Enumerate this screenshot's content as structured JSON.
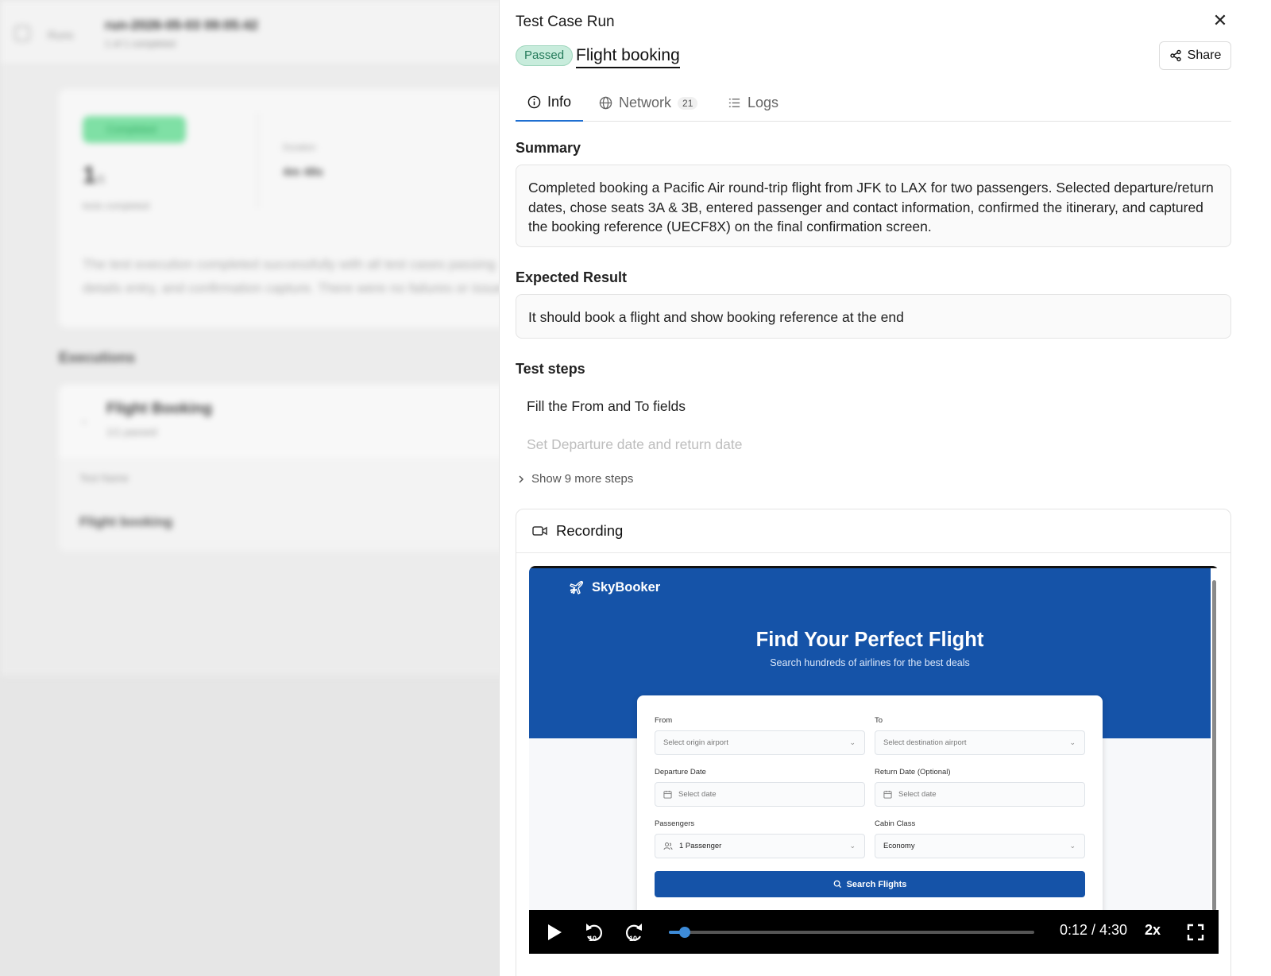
{
  "background": {
    "breadcrumb": "Runs",
    "run_title": "run-2026-05-03 09:05:42",
    "run_subtitle": "1 of 1 completed",
    "status": "Completed",
    "count": "1",
    "count_suffix": "/1",
    "count_label": "tests completed",
    "duration_label": "Duration",
    "duration": "4m 48s",
    "description": "The test execution completed successfully with all test cases passing",
    "description_line2": "details entry, and confirmation capture. There were no failures or issues.",
    "executions_title": "Executions",
    "execution_name": "Flight Booking",
    "execution_sub": "1/1 passed",
    "test_name_label": "Test Name",
    "test_row": "Flight booking"
  },
  "drawer": {
    "title": "Test Case Run",
    "close_symbol": "✕",
    "status": "Passed",
    "case_name": "Flight booking",
    "share_label": "Share",
    "tabs": [
      {
        "label": "Info",
        "icon": "info-icon",
        "count": ""
      },
      {
        "label": "Network",
        "icon": "globe-icon",
        "count": "21"
      },
      {
        "label": "Logs",
        "icon": "list-icon",
        "count": ""
      }
    ],
    "summary_title": "Summary",
    "summary_text": "Completed booking a Pacific Air round-trip flight from JFK to LAX for two passengers. Selected departure/return dates, chose seats 3A & 3B, entered passenger and contact information, confirmed the itinerary, and captured the booking reference (UECF8X) on the final confirmation screen.",
    "expected_title": "Expected Result",
    "expected_text": "It should book a flight and show booking reference at the end",
    "steps_title": "Test steps",
    "steps": [
      "Fill the From and To fields",
      "Set Departure date and return date"
    ],
    "more_steps_label": "Show 9 more steps",
    "recording_title": "Recording"
  },
  "recording": {
    "brand": "SkyBooker",
    "hero_title": "Find Your Perfect Flight",
    "hero_subtitle": "Search hundreds of airlines for the best deals",
    "from_label": "From",
    "from_placeholder": "Select origin airport",
    "to_label": "To",
    "to_placeholder": "Select destination airport",
    "departure_label": "Departure Date",
    "departure_placeholder": "Select date",
    "return_label": "Return Date (Optional)",
    "return_placeholder": "Select date",
    "passengers_label": "Passengers",
    "passengers_value": "1 Passenger",
    "cabin_label": "Cabin Class",
    "cabin_value": "Economy",
    "search_label": "Search Flights"
  },
  "player": {
    "time": "0:12 / 4:30",
    "speed": "2x",
    "progress": 0.044,
    "rewind_seconds": "10",
    "forward_seconds": "10"
  },
  "colors": {
    "accent": "#1f6fd1",
    "hero_blue": "#1553a8",
    "passed_bg": "#c8ecdc",
    "passed_text": "#247a5a"
  }
}
